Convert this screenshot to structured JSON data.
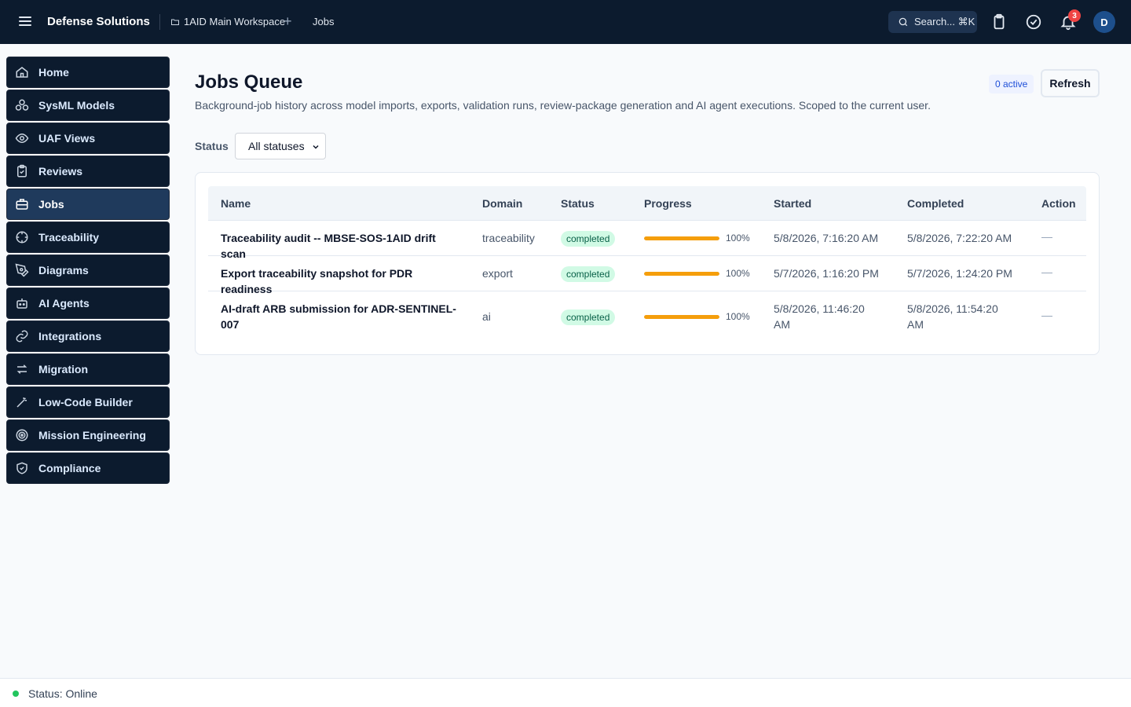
{
  "topbar": {
    "brand": "Defense Solutions",
    "workspace": "1AID Main Workspace",
    "add_symbol": "+",
    "breadcrumb_current": "Jobs",
    "search_label": "Search... ⌘K",
    "notification_count": "3",
    "avatar_initial": "D"
  },
  "sidebar": {
    "items": [
      {
        "label": "Home",
        "icon": "home-icon"
      },
      {
        "label": "SysML Models",
        "icon": "cubes-icon"
      },
      {
        "label": "UAF Views",
        "icon": "eye-icon"
      },
      {
        "label": "Reviews",
        "icon": "clipboard-check-icon"
      },
      {
        "label": "Jobs",
        "icon": "briefcase-icon"
      },
      {
        "label": "Traceability",
        "icon": "crosshair-icon"
      },
      {
        "label": "Diagrams",
        "icon": "pen-tool-icon"
      },
      {
        "label": "AI Agents",
        "icon": "bot-icon"
      },
      {
        "label": "Integrations",
        "icon": "link-icon"
      },
      {
        "label": "Migration",
        "icon": "arrows-swap-icon"
      },
      {
        "label": "Low-Code Builder",
        "icon": "wand-icon"
      },
      {
        "label": "Mission Engineering",
        "icon": "target-icon"
      },
      {
        "label": "Compliance",
        "icon": "shield-check-icon"
      }
    ],
    "active_index": 4
  },
  "main": {
    "title": "Jobs Queue",
    "subtitle": "Background-job history across model imports, exports, validation runs, review-package generation and AI agent executions. Scoped to the current user.",
    "active_badge": "0 active",
    "refresh_label": "Refresh",
    "filter_label": "Status",
    "filter_value": "All statuses"
  },
  "table": {
    "headers": [
      "Name",
      "Domain",
      "Status",
      "Progress",
      "Started",
      "Completed",
      "Action"
    ],
    "rows": [
      {
        "name": "Traceability audit -- MBSE-SOS-1AID drift scan",
        "domain": "traceability",
        "status": "completed",
        "progress": 1.0,
        "progress_label": "100%",
        "started": "5/8/2026, 7:16:20 AM",
        "completed": "5/8/2026, 7:22:20 AM",
        "action": "—"
      },
      {
        "name": "Export traceability snapshot for PDR readiness",
        "domain": "export",
        "status": "completed",
        "progress": 1.0,
        "progress_label": "100%",
        "started": "5/7/2026, 1:16:20 PM",
        "completed": "5/7/2026, 1:24:20 PM",
        "action": "—"
      },
      {
        "name": "AI-draft ARB submission for ADR-SENTINEL-007",
        "domain": "ai",
        "status": "completed",
        "progress": 1.0,
        "progress_label": "100%",
        "started": "5/8/2026, 11:46:20 AM",
        "completed": "5/8/2026, 11:54:20 AM",
        "action": "—"
      }
    ]
  },
  "footer": {
    "status_text": "Status: Online"
  },
  "colors": {
    "topbar": "#0c1b2e",
    "nav_active": "#1f3a5c",
    "progress": "#f59e0b",
    "status_pill": "#d1fae5",
    "online": "#22c55e",
    "badge": "#ef4444"
  }
}
